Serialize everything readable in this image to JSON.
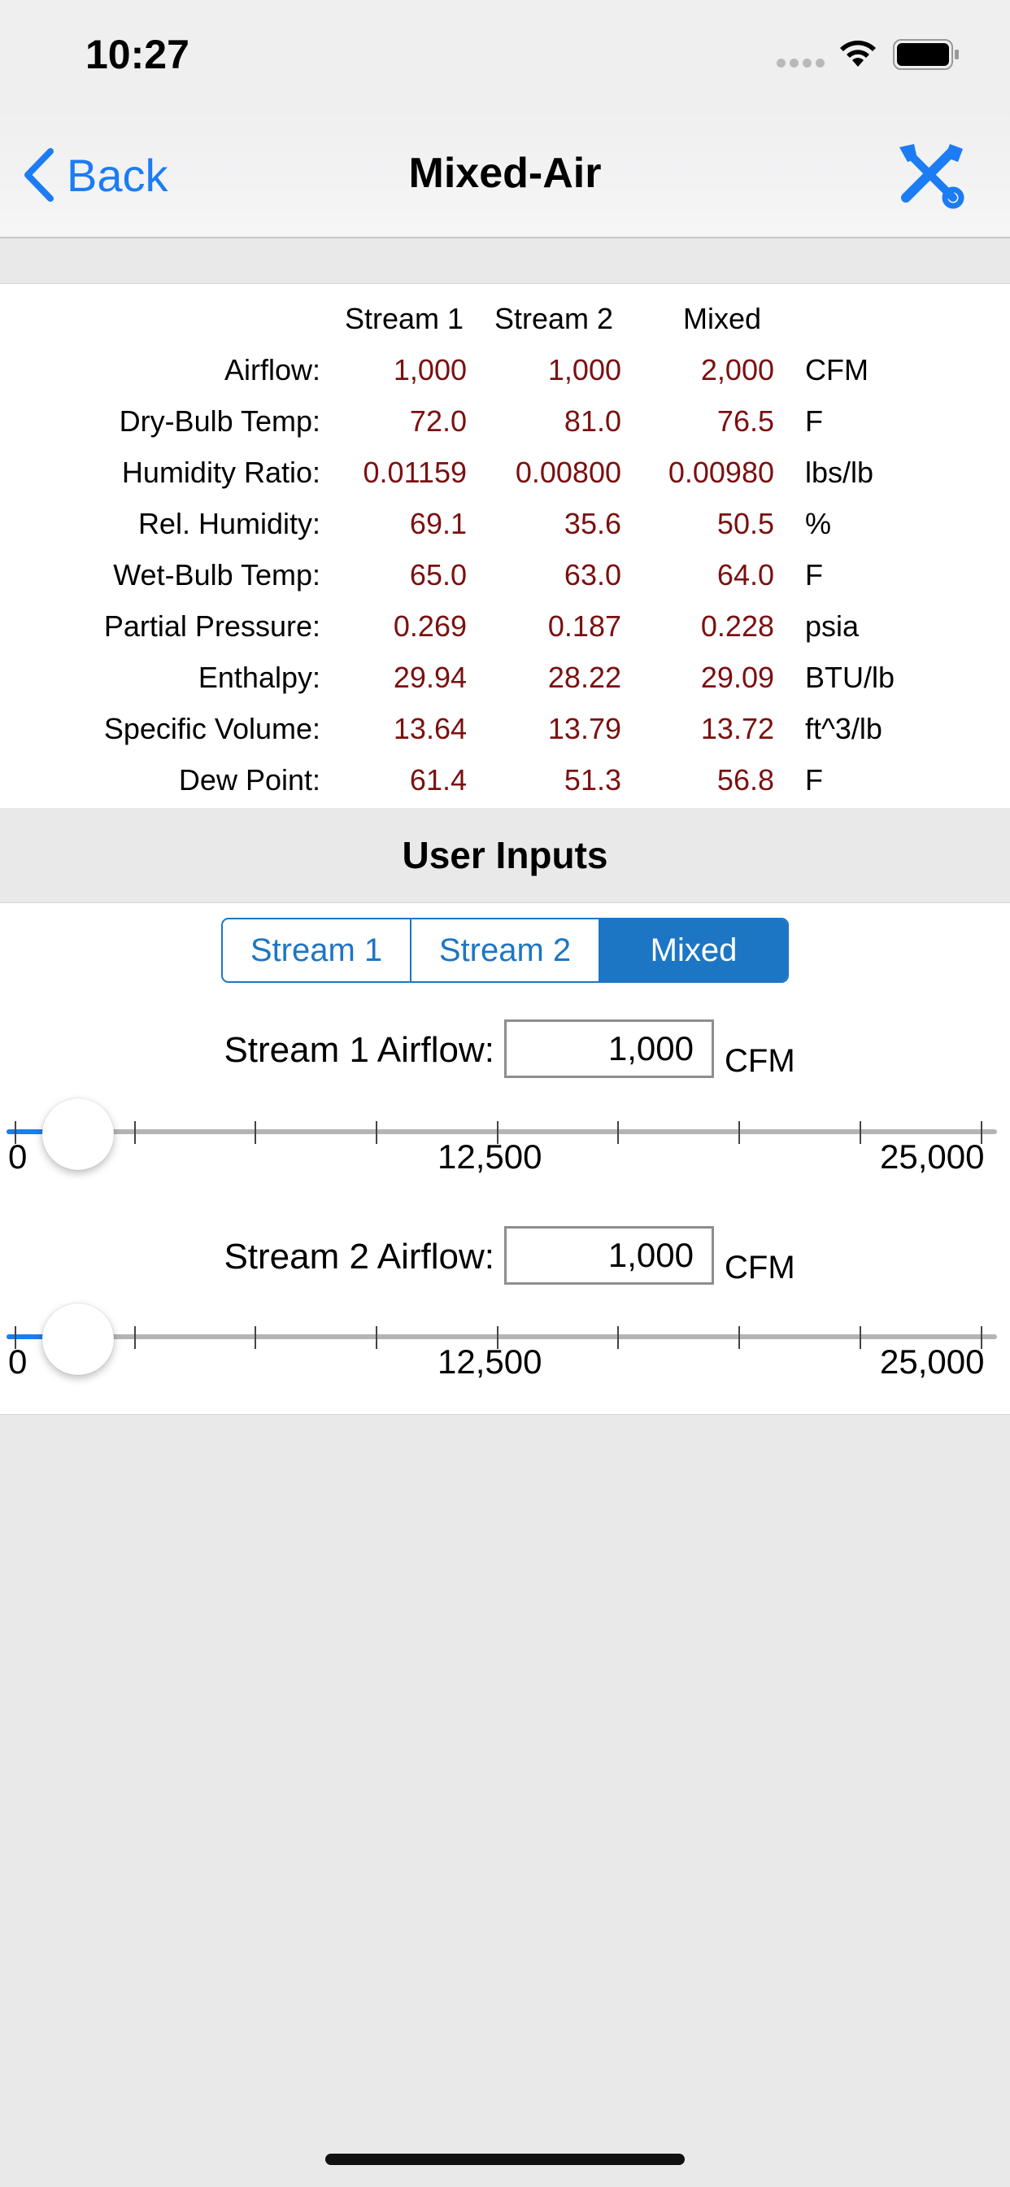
{
  "status_bar": {
    "time": "10:27"
  },
  "nav": {
    "back_label": "Back",
    "title": "Mixed-Air"
  },
  "results": {
    "columns": [
      "Stream 1",
      "Stream 2",
      "Mixed"
    ],
    "rows": [
      {
        "label": "Airflow:",
        "values": [
          "1,000",
          "1,000",
          "2,000"
        ],
        "unit": "CFM"
      },
      {
        "label": "Dry-Bulb Temp:",
        "values": [
          "72.0",
          "81.0",
          "76.5"
        ],
        "unit": "F"
      },
      {
        "label": "Humidity Ratio:",
        "values": [
          "0.01159",
          "0.00800",
          "0.00980"
        ],
        "unit": "lbs/lb"
      },
      {
        "label": "Rel. Humidity:",
        "values": [
          "69.1",
          "35.6",
          "50.5"
        ],
        "unit": "%"
      },
      {
        "label": "Wet-Bulb Temp:",
        "values": [
          "65.0",
          "63.0",
          "64.0"
        ],
        "unit": "F"
      },
      {
        "label": "Partial Pressure:",
        "values": [
          "0.269",
          "0.187",
          "0.228"
        ],
        "unit": "psia"
      },
      {
        "label": "Enthalpy:",
        "values": [
          "29.94",
          "28.22",
          "29.09"
        ],
        "unit": "BTU/lb"
      },
      {
        "label": "Specific Volume:",
        "values": [
          "13.64",
          "13.79",
          "13.72"
        ],
        "unit": "ft^3/lb"
      },
      {
        "label": "Dew Point:",
        "values": [
          "61.4",
          "51.3",
          "56.8"
        ],
        "unit": "F"
      }
    ]
  },
  "inputs": {
    "section_title": "User Inputs",
    "segments": [
      "Stream 1",
      "Stream 2",
      "Mixed"
    ],
    "selected_segment": "Mixed",
    "stream1": {
      "label": "Stream 1 Airflow:",
      "value": "1,000",
      "unit": "CFM",
      "slider_min_label": "0",
      "slider_mid_label": "12,500",
      "slider_max_label": "25,000",
      "slider_value": 1000
    },
    "stream2": {
      "label": "Stream 2 Airflow:",
      "value": "1,000",
      "unit": "CFM",
      "slider_min_label": "0",
      "slider_mid_label": "12,500",
      "slider_max_label": "25,000",
      "slider_value": 1000
    }
  },
  "colors": {
    "accent": "#1c7cf4",
    "segment_blue": "#1d76c3",
    "value_red": "#7b1010"
  }
}
